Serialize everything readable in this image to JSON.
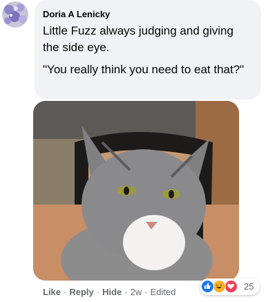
{
  "comment": {
    "author": "Doria A Lenicky",
    "paragraphs": [
      "Little Fuzz always judging and giving the side eye.",
      "\"You really think you need to eat that?\""
    ]
  },
  "actions": {
    "like": "Like",
    "reply": "Reply",
    "hide": "Hide",
    "time": "2w",
    "edited": "Edited",
    "separator": "·"
  },
  "reactions": {
    "icons": [
      "like-icon",
      "haha-icon",
      "love-icon"
    ],
    "count": "25",
    "colors": {
      "like": "#1877f2",
      "haha": "#f7b125",
      "love": "#f33e58"
    }
  }
}
